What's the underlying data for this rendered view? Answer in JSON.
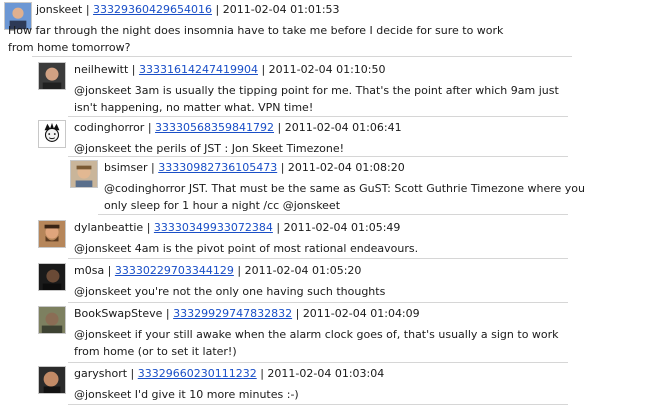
{
  "tweets": [
    {
      "user": "jonskeet",
      "id": "33329360429654016",
      "time": "2011-02-04 01:01:53",
      "text": "How far through the night does insomnia have to take me before I decide for sure to work from home tomorrow?",
      "avatar": "person-avatar-blue"
    },
    {
      "user": "neilhewitt",
      "id": "33331614247419904",
      "time": "2011-02-04 01:10:50",
      "text": "@jonskeet 3am is usually the tipping point for me. That's the point after which 9am just isn't happening, no matter what. VPN time!",
      "avatar": "person-avatar"
    },
    {
      "user": "codinghorror",
      "id": "33330568359841792",
      "time": "2011-02-04 01:06:41",
      "text": "@jonskeet the perils of JST : Jon Skeet Timezone!",
      "avatar": "cartoon-avatar"
    },
    {
      "user": "bsimser",
      "id": "33330982736105473",
      "time": "2011-02-04 01:08:20",
      "text": "@codinghorror JST. That must be the same as GuST: Scott Guthrie Timezone where you only sleep for 1 hour a night /cc @jonskeet",
      "avatar": "person-avatar"
    },
    {
      "user": "dylanbeattie",
      "id": "33330349933072384",
      "time": "2011-02-04 01:05:49",
      "text": "@jonskeet 4am is the pivot point of most rational endeavours.",
      "avatar": "person-avatar"
    },
    {
      "user": "m0sa",
      "id": "33330229703344129",
      "time": "2011-02-04 01:05:20",
      "text": "@jonskeet you're not the only one having such thoughts",
      "avatar": "person-avatar-dark"
    },
    {
      "user": "BookSwapSteve",
      "id": "33329929747832832",
      "time": "2011-02-04 01:04:09",
      "text": "@jonskeet if your still awake when the alarm clock goes of, that's usually a sign to work from home (or to set it later!)",
      "avatar": "person-avatar"
    },
    {
      "user": "garyshort",
      "id": "33329660230111232",
      "time": "2011-02-04 01:03:04",
      "text": "@jonskeet I'd give it 10 more minutes :-)",
      "avatar": "person-avatar-dark"
    }
  ]
}
